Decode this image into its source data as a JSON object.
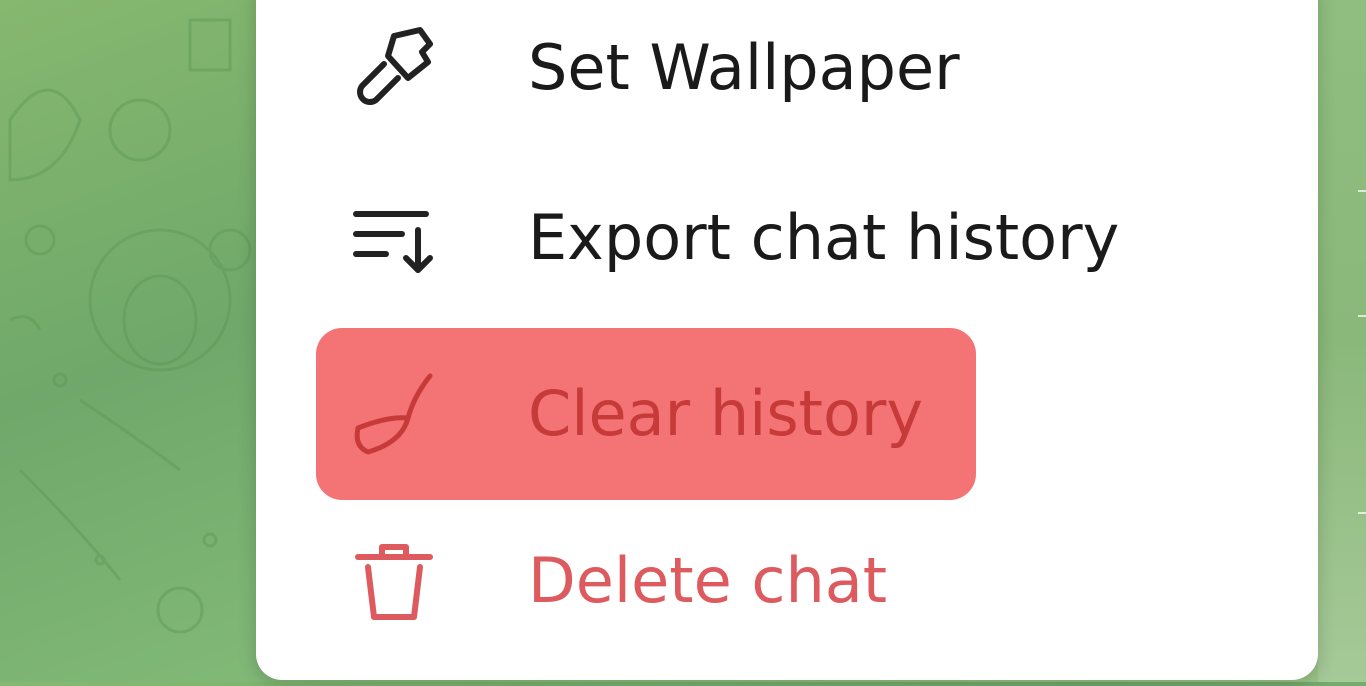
{
  "menu": {
    "items": [
      {
        "label": "Set Wallpaper",
        "icon": "paintbrush-icon"
      },
      {
        "label": "Export chat history",
        "icon": "export-list-icon"
      },
      {
        "label": "Clear history",
        "icon": "broom-icon",
        "highlighted": true
      },
      {
        "label": "Delete chat",
        "icon": "trash-icon",
        "destructive": true
      }
    ]
  },
  "colors": {
    "menu_background": "#ffffff",
    "highlight": "#f47476",
    "highlight_text": "#c73a3a",
    "destructive_text": "#dd5a5f",
    "wallpaper": "#7fb370"
  }
}
